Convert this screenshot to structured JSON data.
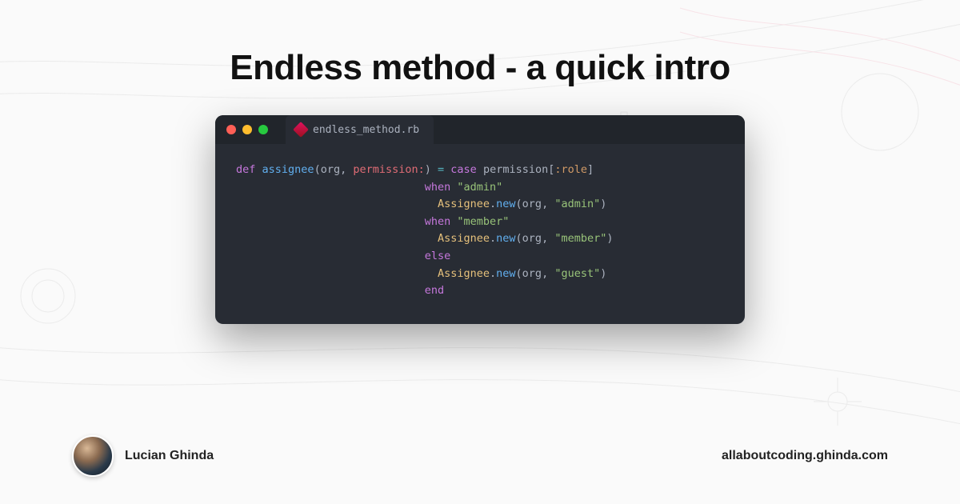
{
  "title": "Endless method - a quick intro",
  "code_tab": {
    "filename": "endless_method.rb"
  },
  "code": {
    "line1": {
      "kw_def": "def",
      "method": "assignee",
      "paren_open": "(",
      "param1": "org",
      "comma": ", ",
      "named_param": "permission:",
      "paren_close": ")",
      "eq": " = ",
      "kw_case": "case",
      "recv": "permission",
      "idx_open": "[",
      "sym": ":role",
      "idx_close": "]"
    },
    "line2": {
      "indent": "                             ",
      "kw_when": "when",
      "str": "\"admin\""
    },
    "line3": {
      "indent": "                               ",
      "klass": "Assignee",
      "dot": ".",
      "meth": "new",
      "open": "(",
      "arg1": "org",
      "comma": ", ",
      "str": "\"admin\"",
      "close": ")"
    },
    "line4": {
      "indent": "                             ",
      "kw_when": "when",
      "str": "\"member\""
    },
    "line5": {
      "indent": "                               ",
      "klass": "Assignee",
      "dot": ".",
      "meth": "new",
      "open": "(",
      "arg1": "org",
      "comma": ", ",
      "str": "\"member\"",
      "close": ")"
    },
    "line6": {
      "indent": "                             ",
      "kw_else": "else"
    },
    "line7": {
      "indent": "                               ",
      "klass": "Assignee",
      "dot": ".",
      "meth": "new",
      "open": "(",
      "arg1": "org",
      "comma": ", ",
      "str": "\"guest\"",
      "close": ")"
    },
    "line8": {
      "indent": "                             ",
      "kw_end": "end"
    }
  },
  "author": {
    "name": "Lucian Ghinda"
  },
  "site": "allaboutcoding.ghinda.com"
}
